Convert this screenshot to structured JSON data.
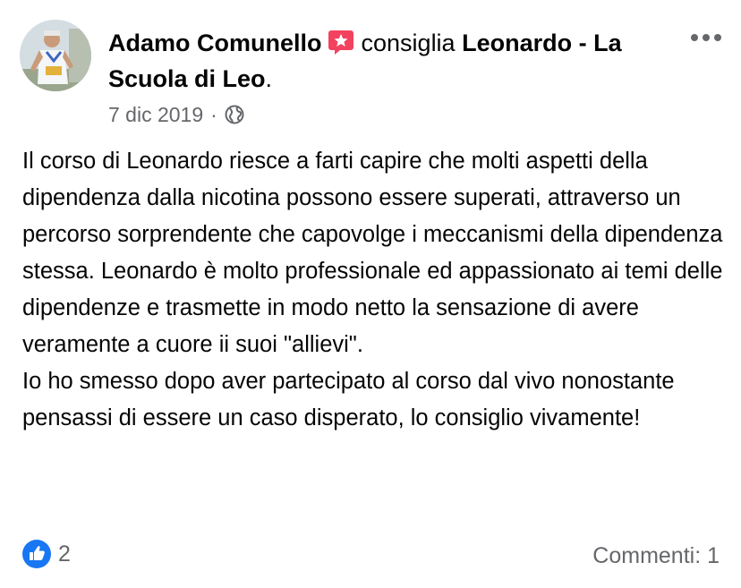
{
  "post": {
    "author": "Adamo Comunello",
    "action": "consiglia",
    "page_name": "Leonardo - La Scuola di Leo",
    "period": ".",
    "date": "7 dic 2019",
    "separator": "·",
    "text": "Il corso di Leonardo riesce a farti capire che molti aspetti della dipendenza dalla nicotina possono essere superati, attraverso un percorso sorprendente che capovolge i meccanismi della dipendenza stessa. Leonardo è molto professionale ed appassionato ai temi delle dipendenze e trasmette in modo netto la sensazione di avere veramente a cuore ii suoi \"allievi\".\nIo ho smesso dopo aver partecipato al corso dal vivo nonostante pensassi di essere un caso disperato, lo consiglio vivamente!",
    "likes_count": "2",
    "comments_label": "Commenti: 1"
  },
  "icons": {
    "badge": "recommendation-star-icon",
    "privacy": "globe-icon",
    "menu": "more-options-icon",
    "reaction": "like-icon"
  },
  "colors": {
    "text": "#050505",
    "secondary": "#65676b",
    "badge": "#f3425f",
    "like": "#1877f2"
  }
}
